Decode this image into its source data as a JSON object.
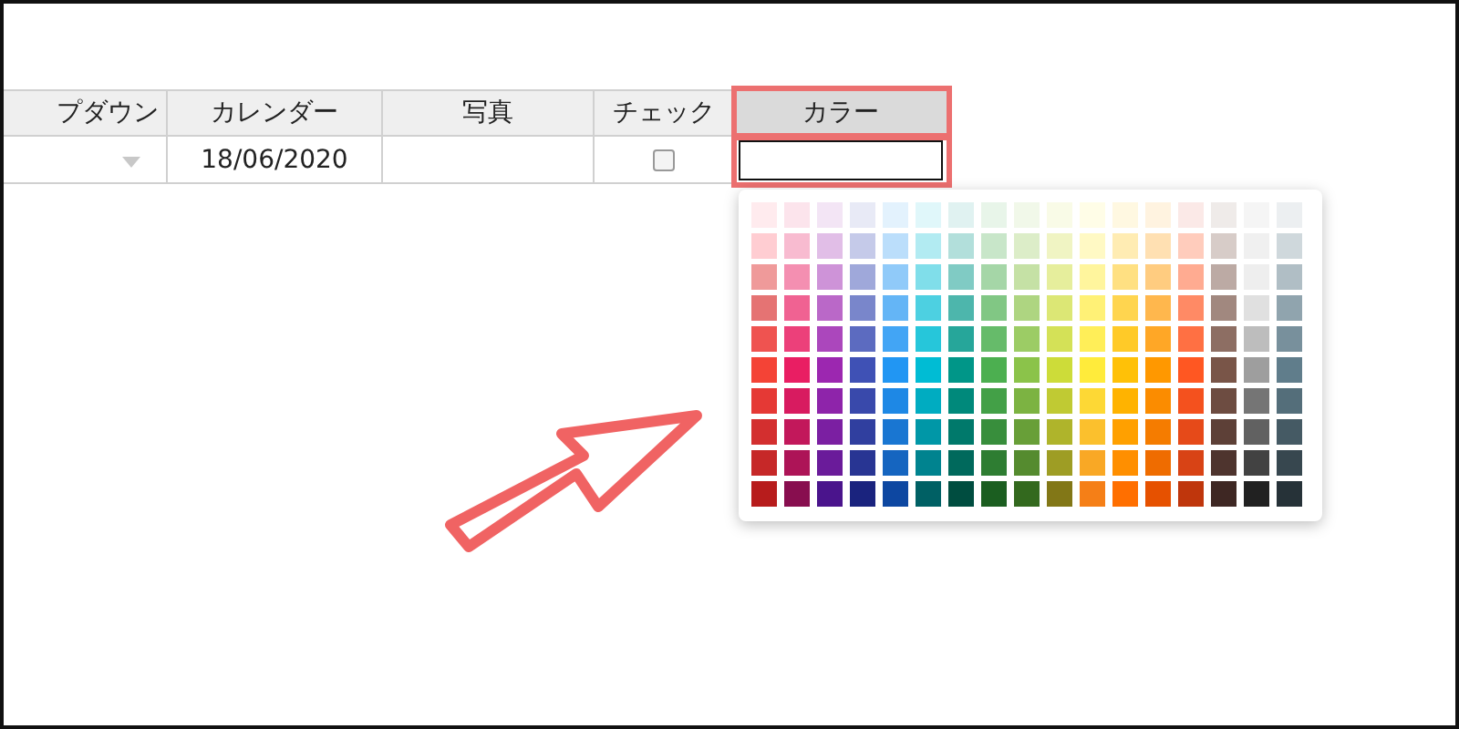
{
  "table": {
    "columns": [
      {
        "label": "プダウン",
        "kind": "dropdown",
        "highlighted": false
      },
      {
        "label": "カレンダー",
        "kind": "date",
        "highlighted": false
      },
      {
        "label": "写真",
        "kind": "photo",
        "highlighted": false
      },
      {
        "label": "チェック",
        "kind": "checkbox",
        "highlighted": false
      },
      {
        "label": "カラー",
        "kind": "color",
        "highlighted": true
      }
    ],
    "row": {
      "date": "18/06/2020",
      "checked": false
    }
  },
  "color_picker": {
    "palette": [
      [
        {
          "color": "#ffebee"
        },
        {
          "color": "#fce4ec"
        },
        {
          "color": "#f3e5f5"
        },
        {
          "color": "#e8eaf6"
        },
        {
          "color": "#e3f2fd"
        },
        {
          "color": "#e0f7fa"
        },
        {
          "color": "#e0f2f1"
        },
        {
          "color": "#e8f5e9"
        },
        {
          "color": "#f1f8e9"
        },
        {
          "color": "#f9fbe7"
        },
        {
          "color": "#fffde7"
        },
        {
          "color": "#fff8e1"
        },
        {
          "color": "#fff3e0"
        },
        {
          "color": "#fbe9e7"
        },
        {
          "color": "#efebe9"
        },
        {
          "color": "#f5f5f5"
        },
        {
          "color": "#eceff1"
        }
      ],
      [
        {
          "color": "#ffcdd2"
        },
        {
          "color": "#f8bbd0"
        },
        {
          "color": "#e1bee7"
        },
        {
          "color": "#c5cae9"
        },
        {
          "color": "#bbdefb"
        },
        {
          "color": "#b2ebf2"
        },
        {
          "color": "#b2dfdb"
        },
        {
          "color": "#c8e6c9"
        },
        {
          "color": "#dcedc8"
        },
        {
          "color": "#f0f4c3"
        },
        {
          "color": "#fff9c4"
        },
        {
          "color": "#ffecb3"
        },
        {
          "color": "#ffe0b2"
        },
        {
          "color": "#ffccbc"
        },
        {
          "color": "#d7ccc8"
        },
        {
          "color": "#f0f0f0"
        },
        {
          "color": "#cfd8dc"
        }
      ],
      [
        {
          "color": "#ef9a9a"
        },
        {
          "color": "#f48fb1"
        },
        {
          "color": "#ce93d8"
        },
        {
          "color": "#9fa8da"
        },
        {
          "color": "#90caf9"
        },
        {
          "color": "#80deea"
        },
        {
          "color": "#80cbc4"
        },
        {
          "color": "#a5d6a7"
        },
        {
          "color": "#c5e1a5"
        },
        {
          "color": "#e6ee9c"
        },
        {
          "color": "#fff59d"
        },
        {
          "color": "#ffe082"
        },
        {
          "color": "#ffcc80"
        },
        {
          "color": "#ffab91"
        },
        {
          "color": "#bcaaa4"
        },
        {
          "color": "#eeeeee"
        },
        {
          "color": "#b0bec5"
        }
      ],
      [
        {
          "color": "#e57373"
        },
        {
          "color": "#f06292"
        },
        {
          "color": "#ba68c8"
        },
        {
          "color": "#7986cb"
        },
        {
          "color": "#64b5f6"
        },
        {
          "color": "#4dd0e1"
        },
        {
          "color": "#4db6ac"
        },
        {
          "color": "#81c784"
        },
        {
          "color": "#aed581"
        },
        {
          "color": "#dce775"
        },
        {
          "color": "#fff176"
        },
        {
          "color": "#ffd54f"
        },
        {
          "color": "#ffb74d"
        },
        {
          "color": "#ff8a65"
        },
        {
          "color": "#a1887f"
        },
        {
          "color": "#e0e0e0"
        },
        {
          "color": "#90a4ae"
        }
      ],
      [
        {
          "color": "#ef5350"
        },
        {
          "color": "#ec407a"
        },
        {
          "color": "#ab47bc"
        },
        {
          "color": "#5c6bc0"
        },
        {
          "color": "#42a5f5"
        },
        {
          "color": "#26c6da"
        },
        {
          "color": "#26a69a"
        },
        {
          "color": "#66bb6a"
        },
        {
          "color": "#9ccc65"
        },
        {
          "color": "#d4e157"
        },
        {
          "color": "#ffee58"
        },
        {
          "color": "#ffca28"
        },
        {
          "color": "#ffa726"
        },
        {
          "color": "#ff7043"
        },
        {
          "color": "#8d6e63"
        },
        {
          "color": "#bdbdbd"
        },
        {
          "color": "#78909c"
        }
      ],
      [
        {
          "color": "#f44336"
        },
        {
          "color": "#e91e63"
        },
        {
          "color": "#9c27b0"
        },
        {
          "color": "#3f51b5"
        },
        {
          "color": "#2196f3"
        },
        {
          "color": "#00bcd4"
        },
        {
          "color": "#009688"
        },
        {
          "color": "#4caf50"
        },
        {
          "color": "#8bc34a"
        },
        {
          "color": "#cddc39"
        },
        {
          "color": "#ffeb3b"
        },
        {
          "color": "#ffc107"
        },
        {
          "color": "#ff9800"
        },
        {
          "color": "#ff5722"
        },
        {
          "color": "#795548"
        },
        {
          "color": "#9e9e9e"
        },
        {
          "color": "#607d8b"
        }
      ],
      [
        {
          "color": "#e53935"
        },
        {
          "color": "#d81b60"
        },
        {
          "color": "#8e24aa"
        },
        {
          "color": "#3949ab"
        },
        {
          "color": "#1e88e5"
        },
        {
          "color": "#00acc1"
        },
        {
          "color": "#00897b"
        },
        {
          "color": "#43a047"
        },
        {
          "color": "#7cb342"
        },
        {
          "color": "#c0ca33"
        },
        {
          "color": "#fdd835"
        },
        {
          "color": "#ffb300"
        },
        {
          "color": "#fb8c00"
        },
        {
          "color": "#f4511e"
        },
        {
          "color": "#6d4c41"
        },
        {
          "color": "#757575"
        },
        {
          "color": "#546e7a"
        }
      ],
      [
        {
          "color": "#d32f2f"
        },
        {
          "color": "#c2185b"
        },
        {
          "color": "#7b1fa2"
        },
        {
          "color": "#303f9f"
        },
        {
          "color": "#1976d2"
        },
        {
          "color": "#0097a7"
        },
        {
          "color": "#00796b"
        },
        {
          "color": "#388e3c"
        },
        {
          "color": "#689f38"
        },
        {
          "color": "#afb42b"
        },
        {
          "color": "#fbc02d"
        },
        {
          "color": "#ffa000"
        },
        {
          "color": "#f57c00"
        },
        {
          "color": "#e64a19"
        },
        {
          "color": "#5d4037"
        },
        {
          "color": "#616161"
        },
        {
          "color": "#455a64"
        }
      ],
      [
        {
          "color": "#c62828"
        },
        {
          "color": "#ad1457"
        },
        {
          "color": "#6a1b9a"
        },
        {
          "color": "#283593"
        },
        {
          "color": "#1565c0"
        },
        {
          "color": "#00838f"
        },
        {
          "color": "#00695c"
        },
        {
          "color": "#2e7d32"
        },
        {
          "color": "#558b2f"
        },
        {
          "color": "#9e9d24"
        },
        {
          "color": "#f9a825"
        },
        {
          "color": "#ff8f00"
        },
        {
          "color": "#ef6c00"
        },
        {
          "color": "#d84315"
        },
        {
          "color": "#4e342e"
        },
        {
          "color": "#424242"
        },
        {
          "color": "#37474f"
        }
      ],
      [
        {
          "color": "#b71c1c"
        },
        {
          "color": "#880e4f"
        },
        {
          "color": "#4a148c"
        },
        {
          "color": "#1a237e"
        },
        {
          "color": "#0d47a1"
        },
        {
          "color": "#006064"
        },
        {
          "color": "#004d40"
        },
        {
          "color": "#1b5e20"
        },
        {
          "color": "#33691e"
        },
        {
          "color": "#827717"
        },
        {
          "color": "#f57f17"
        },
        {
          "color": "#ff6f00"
        },
        {
          "color": "#e65100"
        },
        {
          "color": "#bf360c"
        },
        {
          "color": "#3e2723"
        },
        {
          "color": "#212121"
        },
        {
          "color": "#263238"
        }
      ]
    ]
  }
}
